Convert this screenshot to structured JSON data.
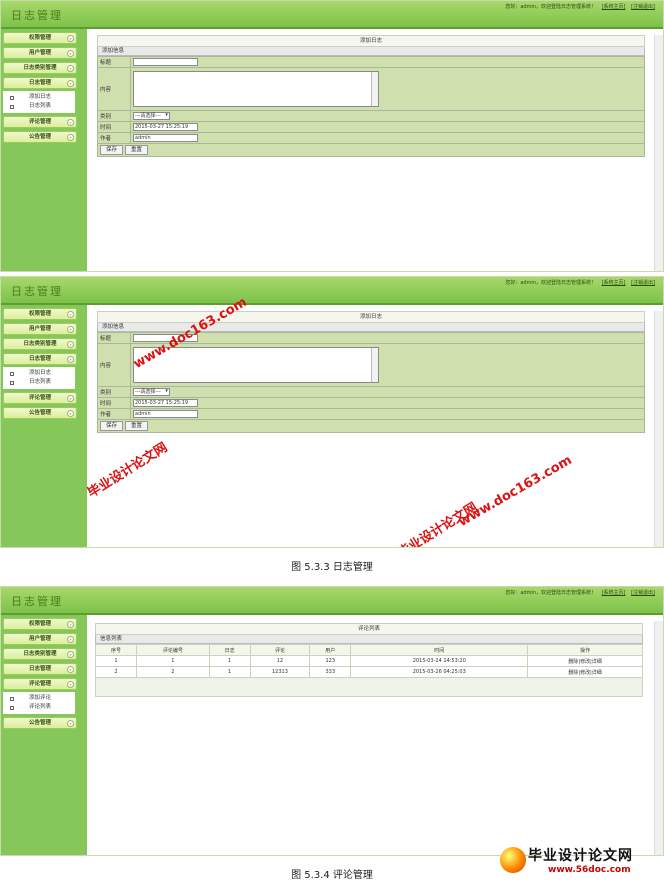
{
  "top": {
    "logo": "日志管理",
    "greeting": "您好：admin，欢迎登陆日志管理系统！",
    "home_link": "[系统主页]",
    "logout_link": "[注销退出]"
  },
  "sidebar": {
    "items": [
      "权限管理",
      "用户管理",
      "日志类别管理",
      "日志管理",
      "评论管理",
      "公告管理"
    ],
    "log_sub": [
      "添加日志",
      "日志列表"
    ],
    "comment_sub": [
      "添加评论",
      "评论列表"
    ]
  },
  "form": {
    "panel_title": "添加日志",
    "subhead": "添加信息",
    "title_label": "标题",
    "content_label": "内容",
    "category_label": "类别",
    "category_value": "---请选择---",
    "time_label": "时间",
    "time_value": "2015-03-27 15:25:19",
    "author_label": "作者",
    "author_value": "admin",
    "save_button": "保存",
    "reset_button": "重置"
  },
  "caption1": "图 5.3.3 日志管理",
  "list": {
    "panel_title": "评论列表",
    "subhead": "信息列表",
    "columns": [
      "序号",
      "评论编号",
      "日志",
      "评论",
      "用户",
      "时间",
      "操作"
    ],
    "rows": [
      [
        "1",
        "1",
        "1",
        "12",
        "123",
        "2015-03-24 14:53:20",
        "删除|修改|详细"
      ],
      [
        "2",
        "2",
        "1",
        "12313",
        "333",
        "2015-03-26 04:25:03",
        "删除|修改|详细"
      ]
    ]
  },
  "caption2": "图 5.3.4 评论管理",
  "watermarks": {
    "site1": "毕业设计论文网",
    "url1": "www.doc163.com",
    "brand_cn": "毕业设计论文网",
    "brand_url": "www.56doc.com"
  },
  "colors": {
    "header": "#7cc24a",
    "sidebar": "#86c75a",
    "form_cell": "#d0dfae",
    "watermark": "#dd1111"
  }
}
